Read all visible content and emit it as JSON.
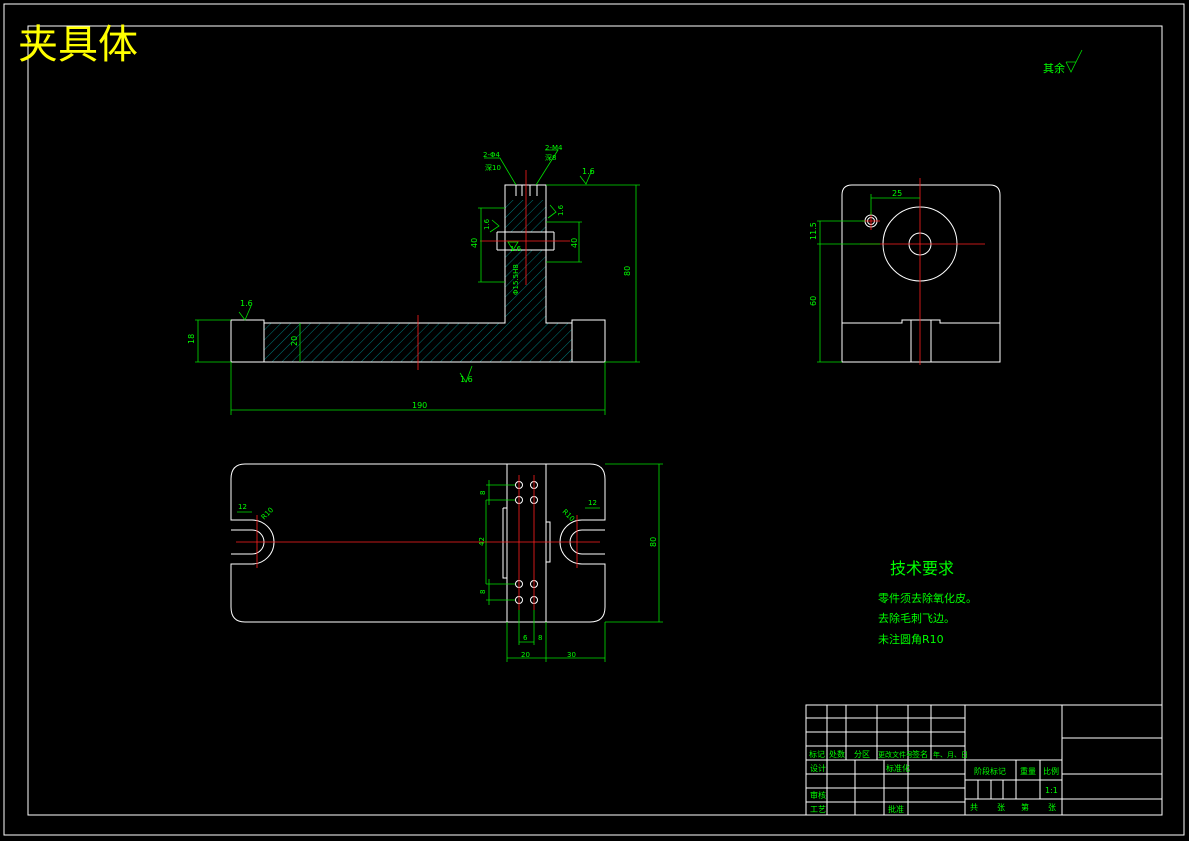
{
  "drawing_title": "夹具体",
  "surface_roughness_note": "其余",
  "technical_requirements": {
    "heading": "技术要求",
    "items": [
      "零件须去除氧化皮。",
      "去除毛刺飞边。",
      "未注圆角R10"
    ]
  },
  "front_view": {
    "dim_total_length": "190",
    "dim_height": "80",
    "dim_base_height": "18",
    "dim_web": "20",
    "dim_slot1": "40",
    "dim_slot2": "40",
    "roughness": [
      "1.6",
      "1.6",
      "1.6",
      "1.6",
      "1.6",
      "1.6"
    ],
    "hole_note_1": "2-Φ4",
    "hole_note_1b": "深10",
    "hole_note_2": "2-M4",
    "hole_note_2b": "深8",
    "bore_note": "Φ15.5H8"
  },
  "side_view": {
    "dim_offset": "25",
    "dim_vertical": "11.5",
    "dim_height": "60"
  },
  "top_view": {
    "dim_width": "80",
    "dim_slot_r": "R10",
    "dim_slot_r2": "R10",
    "dim_12": "12",
    "dim_12b": "12",
    "dim_8a": "8",
    "dim_8b": "8",
    "dim_42": "42",
    "dim_6": "6",
    "dim_8c": "8",
    "dim_20": "20",
    "dim_30": "30"
  },
  "title_block": {
    "row_labels": [
      "标记",
      "处数",
      "分区",
      "更改文件号",
      "签名",
      "年、月、日"
    ],
    "design": "设计",
    "standardize": "标准化",
    "review": "审核",
    "process": "工艺",
    "approve": "批准",
    "stage_mark": "阶段标记",
    "weight": "重量",
    "scale_label": "比例",
    "scale_value": "1:1",
    "sheet_total": "共",
    "sheet_unit": "张",
    "sheet_no": "第",
    "sheet_unit2": "张"
  }
}
